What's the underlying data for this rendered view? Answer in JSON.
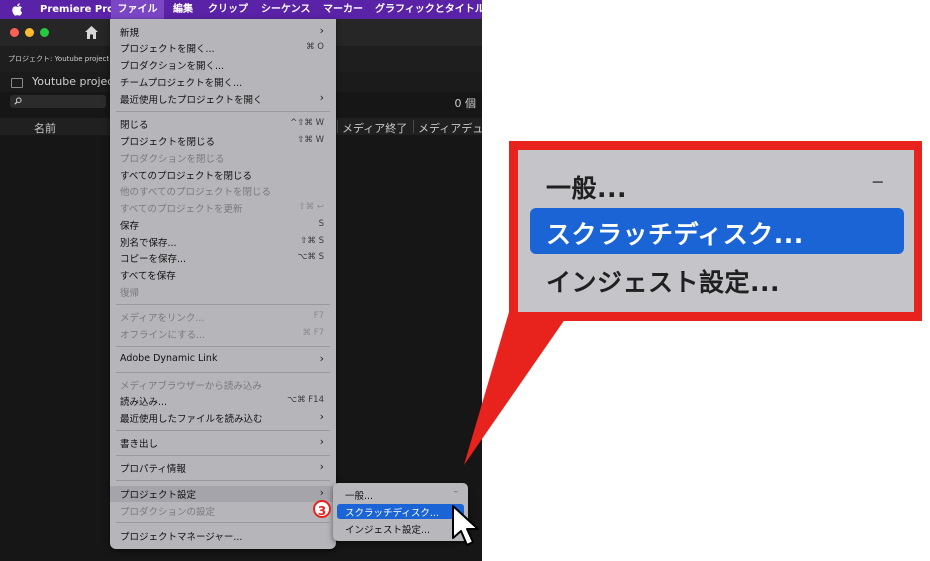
{
  "menubar": {
    "app_name": "Premiere Pro",
    "items": [
      "ファイル",
      "編集",
      "クリップ",
      "シーケンス",
      "マーカー",
      "グラフィックとタイトル"
    ]
  },
  "project_panel": {
    "tab_label": "プロジェクト: Youtube project",
    "project_name": "Youtube project.",
    "item_count": "0 個",
    "columns": [
      "名前",
      "メディア終了",
      "メディアデュ"
    ]
  },
  "file_menu": {
    "new": "新規",
    "open_project": "プロジェクトを開く...",
    "open_project_sc": "⌘ O",
    "open_production": "プロダクションを開く...",
    "open_team_project": "チームプロジェクトを開く...",
    "recent_projects": "最近使用したプロジェクトを開く",
    "close": "閉じる",
    "close_sc": "^⇧⌘ W",
    "close_project": "プロジェクトを閉じる",
    "close_project_sc": "⇧⌘ W",
    "close_production": "プロダクションを閉じる",
    "close_all_projects": "すべてのプロジェクトを閉じる",
    "close_other_projects": "他のすべてのプロジェクトを閉じる",
    "refresh_all_projects": "すべてのプロジェクトを更新",
    "refresh_all_sc": "⇧⌘ ↩",
    "save": "保存",
    "save_sc": "S",
    "save_as": "別名で保存...",
    "save_as_sc": "⇧⌘ S",
    "save_copy": "コピーを保存...",
    "save_copy_sc": "⌥⌘ S",
    "save_all": "すべてを保存",
    "revert": "復帰",
    "link_media": "メディアをリンク...",
    "link_media_sc": "F7",
    "make_offline": "オフラインにする...",
    "make_offline_sc": "⌘ F7",
    "dynamic_link": "Adobe Dynamic Link",
    "import_from_browser": "メディアブラウザーから読み込み",
    "import": "読み込み...",
    "import_sc": "⌥⌘ F14",
    "import_recent": "最近使用したファイルを読み込む",
    "export": "書き出し",
    "properties": "プロパティ情報",
    "project_settings": "プロジェクト設定",
    "production_settings": "プロダクションの設定",
    "project_manager": "プロジェクトマネージャー..."
  },
  "submenu": {
    "general": "一般...",
    "general_sc": "–",
    "scratch_disks": "スクラッチディスク...",
    "ingest_settings": "インジェスト設定..."
  },
  "step_marker": "3",
  "zoom": {
    "general": "一般...",
    "general_sc": "–",
    "scratch_disks": "スクラッチディスク...",
    "ingest_settings": "インジェスト設定..."
  },
  "colors": {
    "menubar": "#5a22a6",
    "highlight": "#1a64d6",
    "callout_red": "#e8231e"
  }
}
